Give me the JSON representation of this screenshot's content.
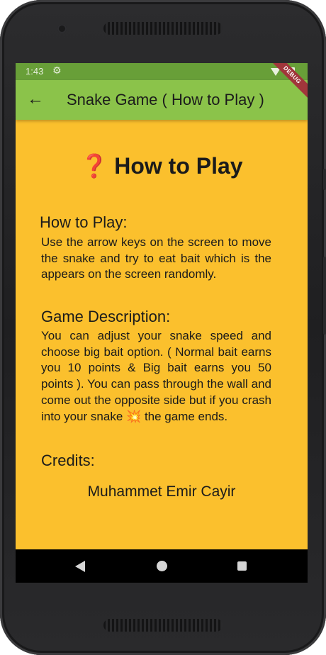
{
  "status_bar": {
    "time": "1:43",
    "debug_label": "DEBUG"
  },
  "app_bar": {
    "title": "Snake Game ( How to Play )"
  },
  "heading": {
    "icon": "❓",
    "text": "How to Play"
  },
  "sections": {
    "how_to_play": {
      "title": "How to Play:",
      "body": "Use the arrow keys on the screen to move the snake and try to eat bait which is the appears on the screen randomly."
    },
    "game_description": {
      "title": "Game Description:",
      "body_text": "You can adjust your snake speed and choose big bait option. ( Normal bait earns you 10 points & Big bait earns you 50 points ). You can pass through the wall and come out the opposite side but if you crash into your snake",
      "body_emoji": "💥",
      "body_end": "the game ends."
    },
    "credits": {
      "title": "Credits:",
      "name": "Muhammet Emir Cayir"
    }
  },
  "icons": {
    "back": "arrow-left-icon",
    "settings": "gear-icon",
    "wifi": "wifi-icon",
    "battery": "battery-icon",
    "nav_back": "triangle-back-icon",
    "nav_home": "circle-home-icon",
    "nav_recent": "square-recents-icon"
  },
  "colors": {
    "background": "#fbc02d",
    "app_bar": "#8bc34a",
    "status_bar": "#689f38",
    "text": "#1b1b1b"
  }
}
